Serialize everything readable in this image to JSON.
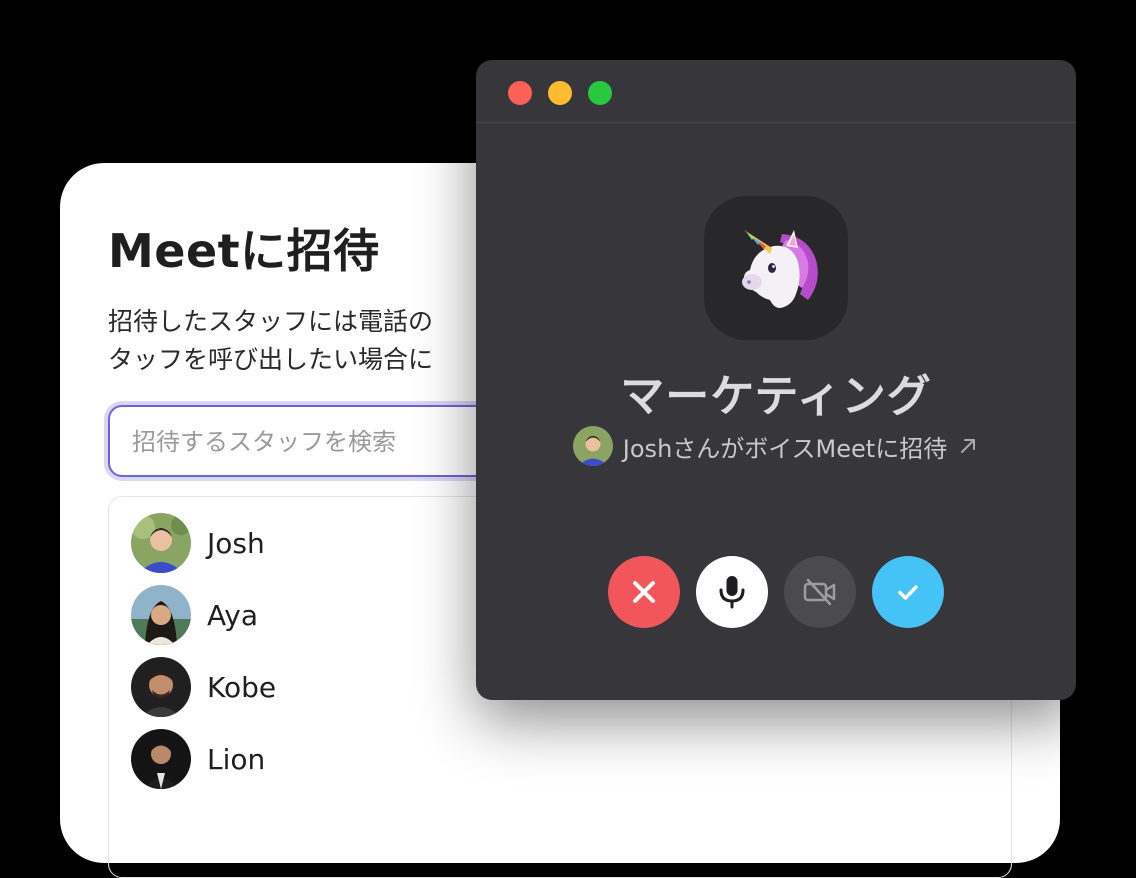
{
  "invite": {
    "title": "Meetに招待",
    "description_line1": "招待したスタッフには電話の",
    "description_line2": "タッフを呼び出したい場合に",
    "search_placeholder": "招待するスタッフを検索",
    "staff": [
      {
        "name": "Josh"
      },
      {
        "name": "Aya"
      },
      {
        "name": "Kobe"
      },
      {
        "name": "Lion"
      }
    ]
  },
  "call": {
    "group_icon": "unicorn-icon",
    "group_name": "マーケティング",
    "invite_text": "JoshさんがボイスMeetに招待",
    "buttons": {
      "decline": "close-icon",
      "mic": "microphone-icon",
      "video": "video-off-icon",
      "accept": "checkmark-icon"
    }
  },
  "colors": {
    "accent_purple": "#6d64d9",
    "decline_red": "#f2565b",
    "accept_blue": "#45c3f6",
    "window_bg": "#37363b"
  }
}
